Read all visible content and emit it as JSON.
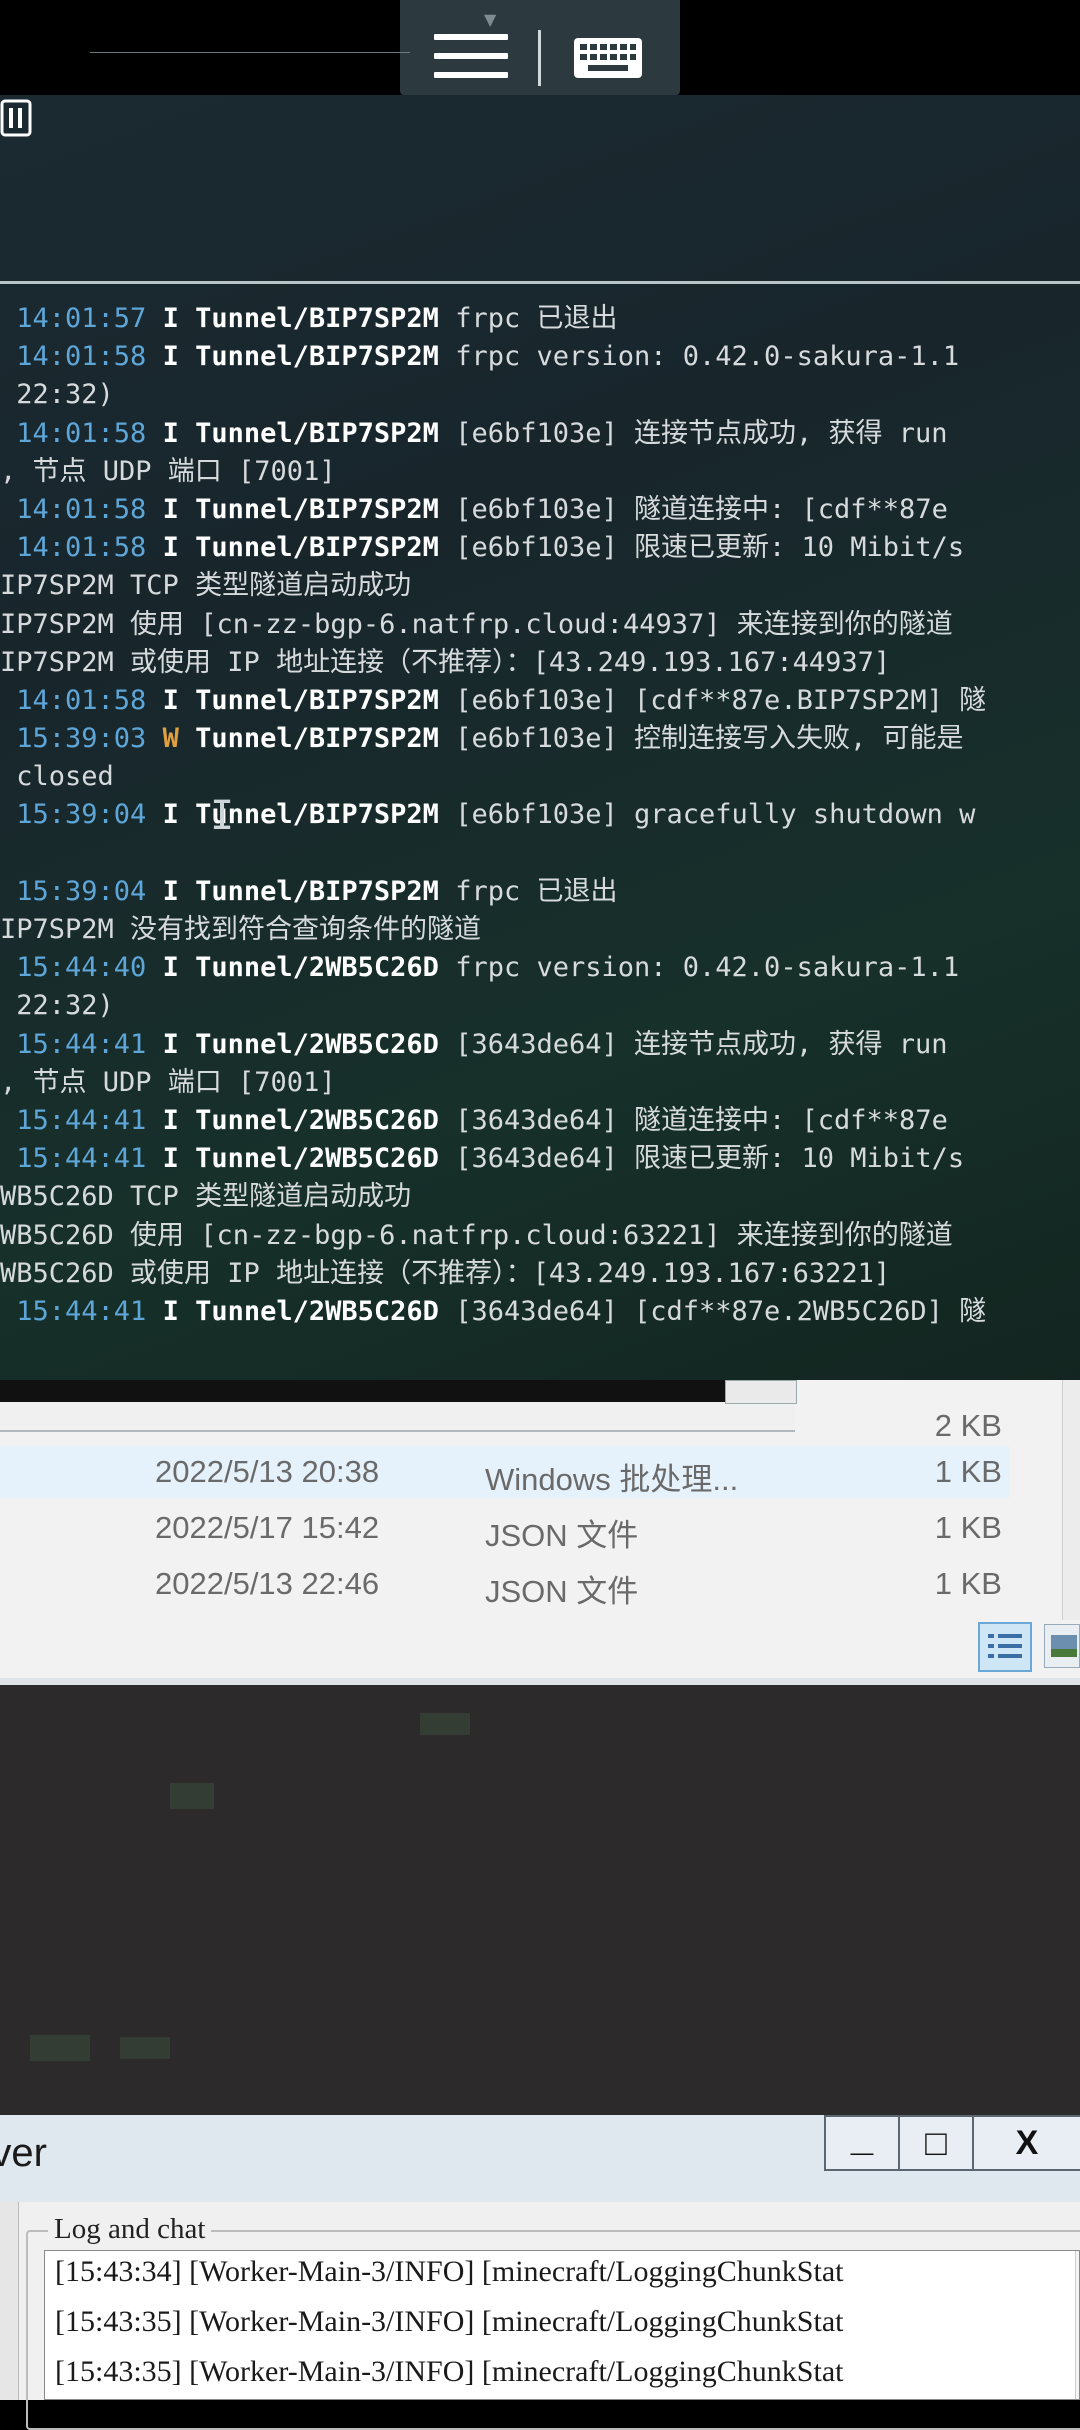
{
  "terminal": {
    "lines": [
      {
        "ts": "14:01:57",
        "lvl": "I",
        "tunnel": "Tunnel/BIP7SP2M",
        "msg": " frpc 已退出"
      },
      {
        "ts": "14:01:58",
        "lvl": "I",
        "tunnel": "Tunnel/BIP7SP2M",
        "msg": " frpc version: 0.42.0-sakura-1.1"
      },
      {
        "plain": " 22:32)"
      },
      {
        "ts": "14:01:58",
        "lvl": "I",
        "tunnel": "Tunnel/BIP7SP2M",
        "msg": " [e6bf103e] 连接节点成功, 获得 run"
      },
      {
        "plain": ", 节点 UDP 端口 [7001]"
      },
      {
        "ts": "14:01:58",
        "lvl": "I",
        "tunnel": "Tunnel/BIP7SP2M",
        "msg": " [e6bf103e] 隧道连接中: [cdf**87e"
      },
      {
        "ts": "14:01:58",
        "lvl": "I",
        "tunnel": "Tunnel/BIP7SP2M",
        "msg": " [e6bf103e] 限速已更新: 10 Mibit/s"
      },
      {
        "plain": "IP7SP2M TCP 类型隧道启动成功"
      },
      {
        "plain": "IP7SP2M 使用 [cn-zz-bgp-6.natfrp.cloud:44937] 来连接到你的隧道"
      },
      {
        "plain": "IP7SP2M 或使用 IP 地址连接（不推荐）：[43.249.193.167:44937]"
      },
      {
        "ts": "14:01:58",
        "lvl": "I",
        "tunnel": "Tunnel/BIP7SP2M",
        "msg": " [e6bf103e] [cdf**87e.BIP7SP2M] 隧"
      },
      {
        "ts": "15:39:03",
        "lvl": "W",
        "tunnel": "Tunnel/BIP7SP2M",
        "msg": " [e6bf103e] 控制连接写入失败, 可能是"
      },
      {
        "plain": " closed"
      },
      {
        "ts": "15:39:04",
        "lvl": "I",
        "tunnel": "Tunnel/BIP7SP2M",
        "msg": " [e6bf103e] gracefully shutdown w"
      },
      {
        "plain": ""
      },
      {
        "ts": "15:39:04",
        "lvl": "I",
        "tunnel": "Tunnel/BIP7SP2M",
        "msg": " frpc 已退出"
      },
      {
        "plain": "IP7SP2M 没有找到符合查询条件的隧道"
      },
      {
        "ts": "15:44:40",
        "lvl": "I",
        "tunnel": "Tunnel/2WB5C26D",
        "msg": " frpc version: 0.42.0-sakura-1.1"
      },
      {
        "plain": " 22:32)"
      },
      {
        "ts": "15:44:41",
        "lvl": "I",
        "tunnel": "Tunnel/2WB5C26D",
        "msg": " [3643de64] 连接节点成功, 获得 run"
      },
      {
        "plain": ", 节点 UDP 端口 [7001]"
      },
      {
        "ts": "15:44:41",
        "lvl": "I",
        "tunnel": "Tunnel/2WB5C26D",
        "msg": " [3643de64] 隧道连接中: [cdf**87e"
      },
      {
        "ts": "15:44:41",
        "lvl": "I",
        "tunnel": "Tunnel/2WB5C26D",
        "msg": " [3643de64] 限速已更新: 10 Mibit/s"
      },
      {
        "plain": "WB5C26D TCP 类型隧道启动成功"
      },
      {
        "plain": "WB5C26D 使用 [cn-zz-bgp-6.natfrp.cloud:63221] 来连接到你的隧道"
      },
      {
        "plain": "WB5C26D 或使用 IP 地址连接（不推荐）：[43.249.193.167:63221]"
      },
      {
        "ts": "15:44:41",
        "lvl": "I",
        "tunnel": "Tunnel/2WB5C26D",
        "msg": " [3643de64] [cdf**87e.2WB5C26D] 隧"
      }
    ]
  },
  "explorer": {
    "rows": [
      {
        "date": "",
        "type": "",
        "size": "2 KB",
        "selected": false
      },
      {
        "date": "2022/5/13 20:38",
        "type": "Windows 批处理...",
        "size": "1 KB",
        "selected": true
      },
      {
        "date": "2022/5/17 15:42",
        "type": "JSON 文件",
        "size": "1 KB",
        "selected": false
      },
      {
        "date": "2022/5/13 22:46",
        "type": "JSON 文件",
        "size": "1 KB",
        "selected": false
      }
    ]
  },
  "server": {
    "title": "rver",
    "minimize": "_",
    "maximize": "□",
    "close": "X",
    "group_label": "Log and chat",
    "chat": [
      "[15:43:34] [Worker-Main-3/INFO] [minecraft/LoggingChunkStat",
      "[15:43:35] [Worker-Main-3/INFO] [minecraft/LoggingChunkStat",
      "[15:43:35] [Worker-Main-3/INFO] [minecraft/LoggingChunkStat"
    ],
    "scroll_up": "^"
  },
  "icons": {
    "menu": "hamburger-icon",
    "keyboard": "keyboard-icon",
    "window": "window-icon",
    "cursor": "I"
  }
}
